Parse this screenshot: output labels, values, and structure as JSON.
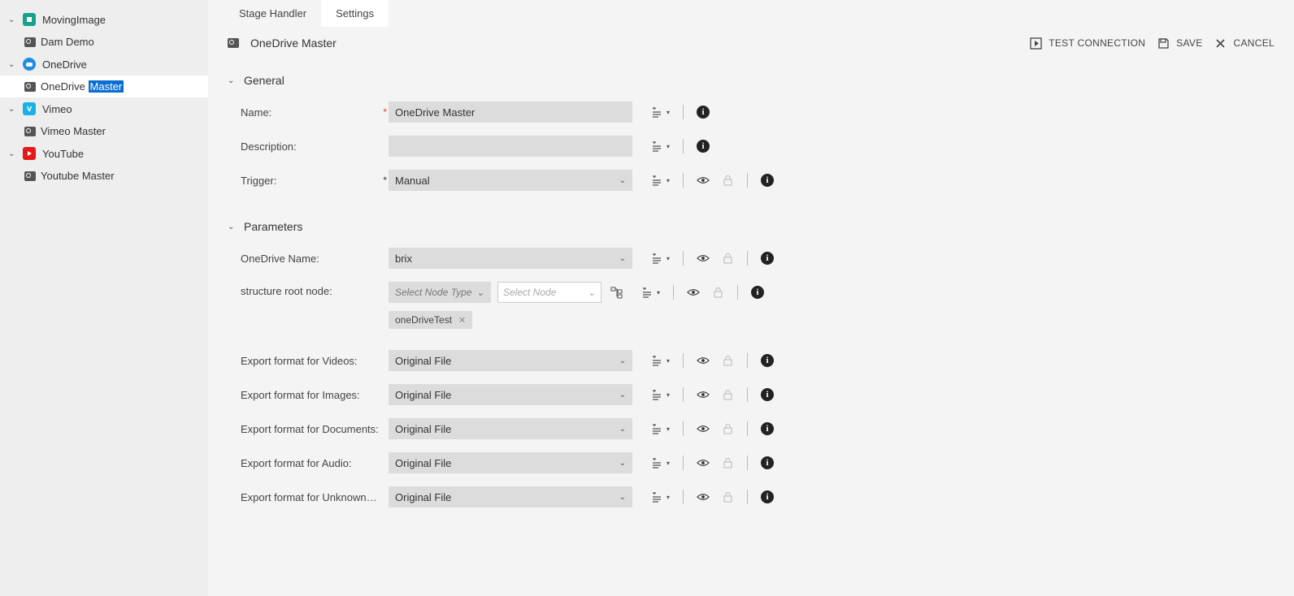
{
  "sidebar": {
    "groups": [
      {
        "label": "MovingImage",
        "brand": "mi",
        "children": [
          {
            "label": "Dam Demo"
          }
        ]
      },
      {
        "label": "OneDrive",
        "brand": "od",
        "children": [
          {
            "label_pre": "OneDrive ",
            "label_hl": "Master",
            "selected": true
          }
        ]
      },
      {
        "label": "Vimeo",
        "brand": "vi",
        "children": [
          {
            "label": "Vimeo Master"
          }
        ]
      },
      {
        "label": "YouTube",
        "brand": "yt",
        "children": [
          {
            "label": "Youtube Master"
          }
        ]
      }
    ]
  },
  "tabs": {
    "stage": "Stage Handler",
    "settings": "Settings"
  },
  "header": {
    "title": "OneDrive Master",
    "test": "TEST CONNECTION",
    "save": "SAVE",
    "cancel": "CANCEL"
  },
  "sections": {
    "general": "General",
    "parameters": "Parameters"
  },
  "general": {
    "name_lbl": "Name:",
    "name_val": "OneDrive Master",
    "desc_lbl": "Description:",
    "desc_val": "",
    "trig_lbl": "Trigger:",
    "trig_val": "Manual"
  },
  "params": {
    "odname_lbl": "OneDrive Name:",
    "odname_val": "brix",
    "root_lbl": "structure root node:",
    "root_type_ph": "Select Node Type",
    "root_node_ph": "Select Node",
    "root_chip": "oneDriveTest",
    "fmt_video_lbl": "Export format for Videos:",
    "fmt_video_val": "Original File",
    "fmt_image_lbl": "Export format for Images:",
    "fmt_image_val": "Original File",
    "fmt_doc_lbl": "Export format for Documents:",
    "fmt_doc_val": "Original File",
    "fmt_audio_lbl": "Export format for Audio:",
    "fmt_audio_val": "Original File",
    "fmt_unk_lbl": "Export format for Unknown Filec...",
    "fmt_unk_val": "Original File"
  }
}
